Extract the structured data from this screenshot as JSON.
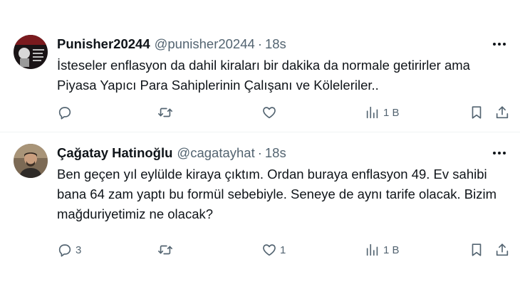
{
  "tweets": [
    {
      "name": "Punisher20244",
      "handle": "@punisher20244",
      "separator": "·",
      "time": "18s",
      "text_lines": [
        "İsteseler enflasyon da dahil kiraları bir dakika da normale getirirler ama",
        "Piyasa Yapıcı Para Sahiplerinin Çalışanı ve Köleleriler.."
      ],
      "reply_count": "",
      "retweet_count": "",
      "like_count": "",
      "views_count": "1 B"
    },
    {
      "name": "Çağatay Hatinoğlu",
      "handle": "@cagatayhat",
      "separator": "·",
      "time": "18s",
      "text_lines": [
        "Ben geçen yıl eylülde kiraya çıktım. Ordan buraya enflasyon 49. Ev sahibi",
        "bana 64 zam yaptı bu formül sebebiyle. Seneye de aynı tarife olacak. Bizim",
        "mağduriyetimiz ne olacak?"
      ],
      "reply_count": "3",
      "retweet_count": "",
      "like_count": "1",
      "views_count": "1 B"
    }
  ],
  "icons": {
    "more": "more-dots-icon",
    "reply": "reply-bubble-icon",
    "retweet": "retweet-icon",
    "like": "heart-icon",
    "views": "views-bars-icon",
    "bookmark": "bookmark-icon",
    "share": "share-upload-icon"
  },
  "colors": {
    "text": "#0f1419",
    "secondary": "#536471",
    "divider": "#eff3f4"
  }
}
